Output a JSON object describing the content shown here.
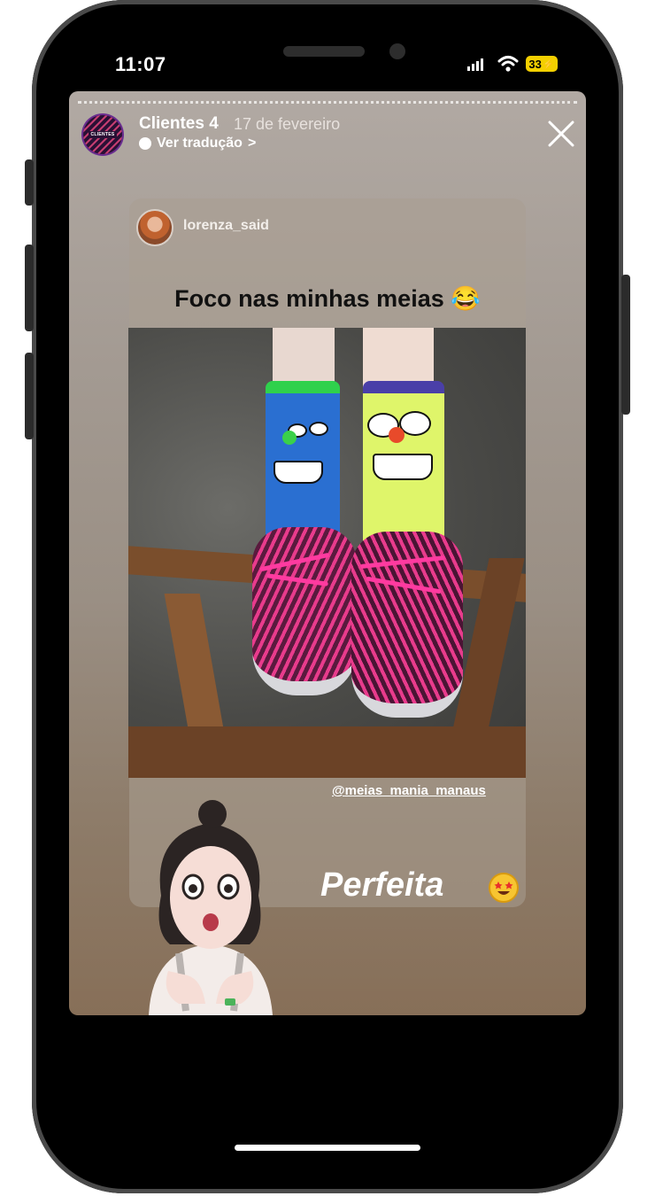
{
  "status_bar": {
    "time": "11:07",
    "battery": "33"
  },
  "story": {
    "account_name": "Clientes 4",
    "date": "17 de fevereiro",
    "translate_label": "Ver tradução",
    "translate_chevron": ">",
    "avatar_text": "CLIENTES",
    "close_icon": "close-icon"
  },
  "repost": {
    "username": "lorenza_said",
    "caption": "Foco nas minhas meias 😂",
    "mention": "@meias_mania_manaus",
    "sticker_text": "Perfeita"
  },
  "colors": {
    "battery": "#f4d000",
    "story_top": "#b1a9a3",
    "story_bottom": "#876f58",
    "lace": "#ff3aa0"
  }
}
